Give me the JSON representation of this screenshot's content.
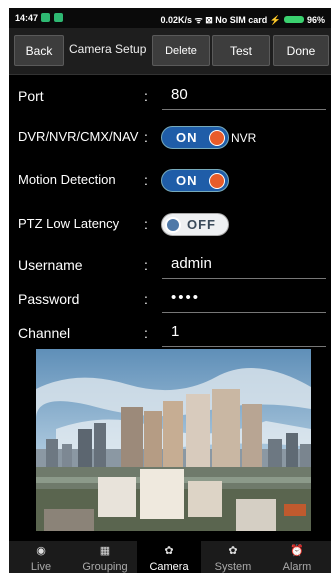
{
  "status": {
    "time": "14:47",
    "right_text": "0.02K/s  ᯤ ⊠ No SIM card ⚡ ",
    "battery": "96%",
    "battery_color": "#3bd16f",
    "app_icon_color": "#2eb872"
  },
  "toolbar": {
    "back": "Back",
    "title": "Camera Setup",
    "delete": "Delete",
    "test": "Test",
    "done": "Done"
  },
  "form": {
    "port_label": "Port",
    "port_value": "80",
    "dvr_label": "DVR/NVR/CMX/NAV",
    "dvr_state": "ON",
    "dvr_mode": "NVR",
    "motion_label": "Motion Detection",
    "motion_state": "ON",
    "ptz_label": "PTZ Low Latency",
    "ptz_state": "OFF",
    "user_label": "Username",
    "user_value": "admin",
    "pass_label": "Password",
    "pass_value": "••••",
    "channel_label": "Channel",
    "channel_value": "1",
    "colon": ":"
  },
  "tabs": [
    {
      "label": "Live",
      "icon": "live-icon"
    },
    {
      "label": "Grouping",
      "icon": "grouping-icon"
    },
    {
      "label": "Camera",
      "icon": "camera-gear-icon"
    },
    {
      "label": "System",
      "icon": "system-gear-icon"
    },
    {
      "label": "Alarm",
      "icon": "alarm-clock-icon"
    }
  ]
}
